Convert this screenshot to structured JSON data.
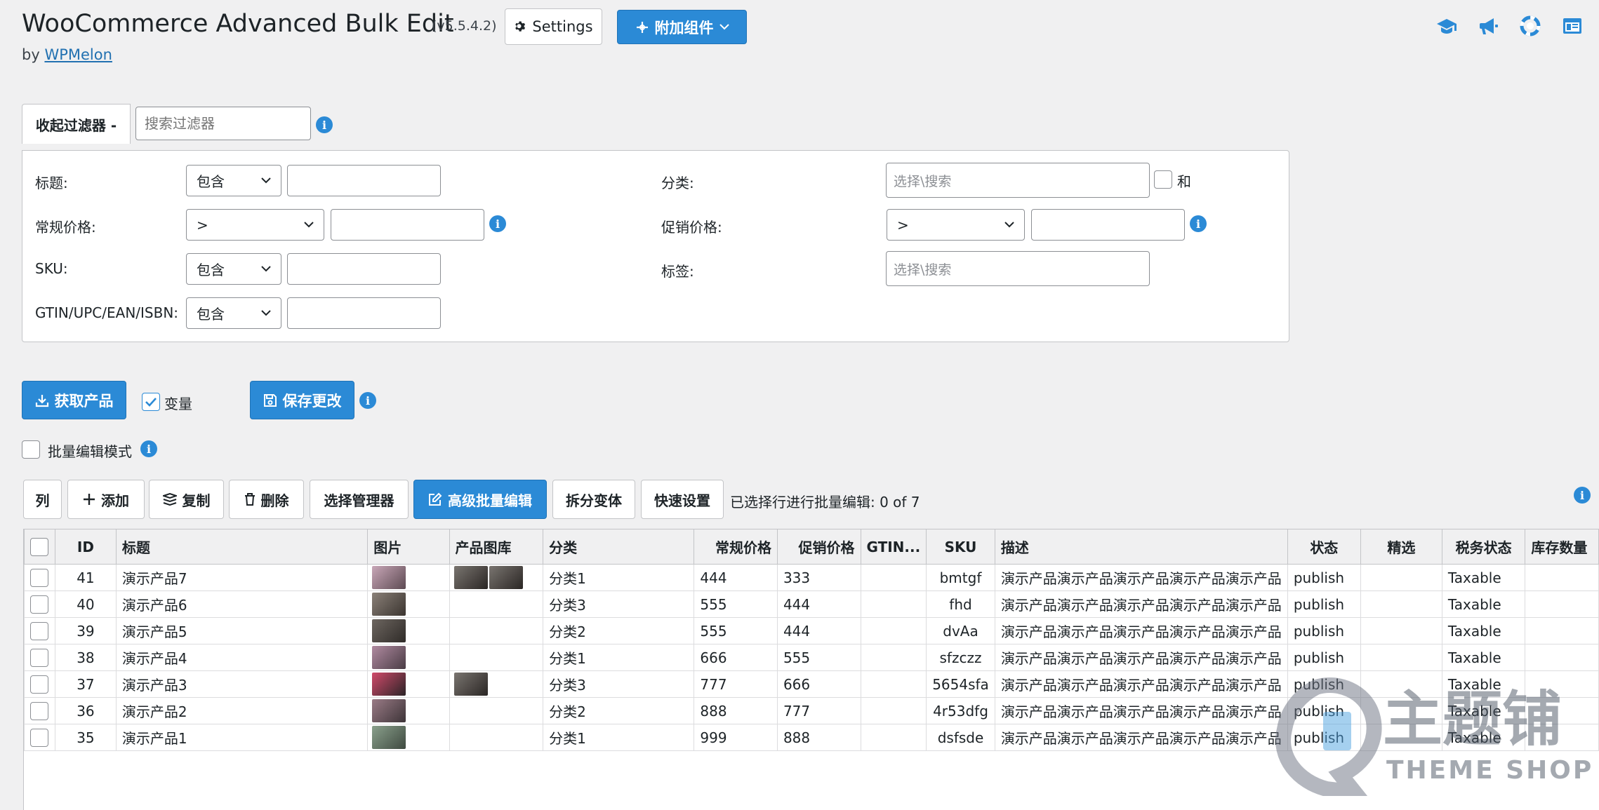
{
  "header": {
    "title": "WooCommerce Advanced Bulk Edit",
    "version": "(v5.5.4.2)",
    "by_prefix": "by",
    "by_link": "WPMelon",
    "settings_label": "Settings",
    "addons_label": "附加组件"
  },
  "top_icons": [
    "graduation-cap-icon",
    "megaphone-icon",
    "support-icon",
    "layout-icon"
  ],
  "filters": {
    "toggle_label": "收起过滤器 -",
    "search_placeholder": "搜索过滤器",
    "title_label": "标题:",
    "title_op": "包含",
    "regular_price_label": "常规价格:",
    "regular_price_op": ">",
    "sku_label": "SKU:",
    "sku_op": "包含",
    "gtin_label": "GTIN/UPC/EAN/ISBN:",
    "gtin_op": "包含",
    "category_label": "分类:",
    "category_placeholder": "选择\\搜索",
    "category_and": "和",
    "sale_price_label": "促销价格:",
    "sale_price_op": ">",
    "tags_label": "标签:",
    "tags_placeholder": "选择\\搜索"
  },
  "actions": {
    "get_products": "获取产品",
    "variations_label": "变量",
    "save_changes": "保存更改",
    "bulk_edit_mode": "批量编辑模式"
  },
  "toolbar": {
    "columns": "列",
    "add": "添加",
    "duplicate": "复制",
    "delete": "删除",
    "selection_manager": "选择管理器",
    "advanced_bulk_edit": "高级批量编辑",
    "split_variations": "拆分变体",
    "quick_settings": "快速设置",
    "selection_status": "已选择行进行批量编辑:  0 of 7"
  },
  "colors": {
    "accent": "#2b8ad6",
    "background": "#f0f0f1",
    "link": "#2271b1"
  },
  "table": {
    "columns": [
      "ID",
      "标题",
      "图片",
      "产品图库",
      "分类",
      "常规价格",
      "促销价格",
      "GTIN...",
      "SKU",
      "描述",
      "状态",
      "精选",
      "税务状态",
      "库存数量"
    ],
    "rows": [
      {
        "id": "41",
        "title": "演示产品7",
        "category": "分类1",
        "regular": "444",
        "sale": "333",
        "gtin": "",
        "sku": "bmtgf",
        "desc": "演示产品演示产品演示产品演示产品演示产品",
        "status": "publish",
        "featured": "",
        "tax": "Taxable",
        "stock": ""
      },
      {
        "id": "40",
        "title": "演示产品6",
        "category": "分类3",
        "regular": "555",
        "sale": "444",
        "gtin": "",
        "sku": "fhd",
        "desc": "演示产品演示产品演示产品演示产品演示产品",
        "status": "publish",
        "featured": "",
        "tax": "Taxable",
        "stock": ""
      },
      {
        "id": "39",
        "title": "演示产品5",
        "category": "分类2",
        "regular": "555",
        "sale": "444",
        "gtin": "",
        "sku": "dvAa",
        "desc": "演示产品演示产品演示产品演示产品演示产品",
        "status": "publish",
        "featured": "",
        "tax": "Taxable",
        "stock": ""
      },
      {
        "id": "38",
        "title": "演示产品4",
        "category": "分类1",
        "regular": "666",
        "sale": "555",
        "gtin": "",
        "sku": "sfzczz",
        "desc": "演示产品演示产品演示产品演示产品演示产品",
        "status": "publish",
        "featured": "",
        "tax": "Taxable",
        "stock": ""
      },
      {
        "id": "37",
        "title": "演示产品3",
        "category": "分类3",
        "regular": "777",
        "sale": "666",
        "gtin": "",
        "sku": "5654sfa",
        "desc": "演示产品演示产品演示产品演示产品演示产品",
        "status": "publish",
        "featured": "",
        "tax": "Taxable",
        "stock": ""
      },
      {
        "id": "36",
        "title": "演示产品2",
        "category": "分类2",
        "regular": "888",
        "sale": "777",
        "gtin": "",
        "sku": "4r53dfg",
        "desc": "演示产品演示产品演示产品演示产品演示产品",
        "status": "publish",
        "featured": "",
        "tax": "Taxable",
        "stock": ""
      },
      {
        "id": "35",
        "title": "演示产品1",
        "category": "分类1",
        "regular": "999",
        "sale": "888",
        "gtin": "",
        "sku": "dsfsde",
        "desc": "演示产品演示产品演示产品演示产品演示产品",
        "status": "publish",
        "featured": "",
        "tax": "Taxable",
        "stock": ""
      }
    ]
  },
  "watermark": {
    "brand": "主题铺",
    "sub": "THEME SHOP"
  }
}
